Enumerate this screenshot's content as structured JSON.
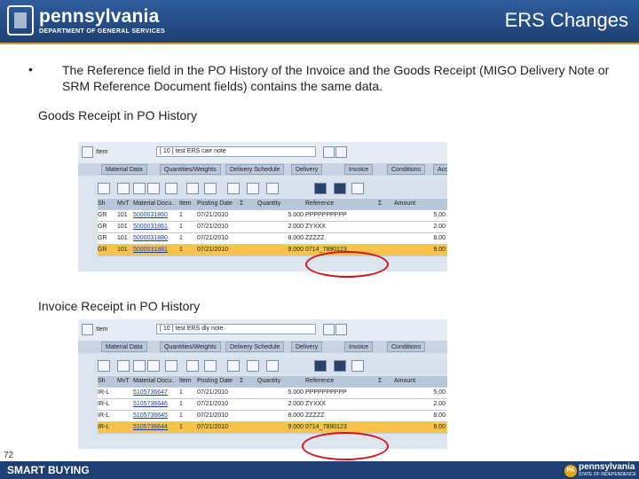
{
  "header": {
    "logo_text": "pennsylvania",
    "logo_subtext": "DEPARTMENT OF GENERAL SERVICES",
    "title": "ERS Changes"
  },
  "body": {
    "bullet": "•",
    "text": "The Reference field in the PO History of the Invoice and the Goods Receipt (MIGO Delivery Note or SRM Reference Document fields) contains the same data."
  },
  "gr": {
    "caption": "Goods Receipt in PO History",
    "item_label": "Item",
    "item_value": "[ 10 ] test ERS carr note",
    "tabs": [
      "Material Data",
      "Quantities/Weights",
      "Delivery Schedule",
      "Delivery",
      "Invoice",
      "Conditions",
      "Account As"
    ],
    "columns": [
      "Sh",
      "MvT",
      "Material Docu..",
      "Item",
      "Posting Date",
      "Σ",
      "Quantity",
      "Reference",
      "Σ",
      "Amount"
    ],
    "rows": [
      [
        "GR",
        "101",
        "5000031860",
        "1",
        "07/21/2010",
        "",
        "5.000",
        "PPPPPPPPPP",
        "",
        "5.00"
      ],
      [
        "GR",
        "101",
        "5000031861",
        "1",
        "07/21/2010",
        "",
        "2.000",
        "ZYXXX",
        "",
        "2.00"
      ],
      [
        "GR",
        "101",
        "5000031880",
        "1",
        "07/21/2010",
        "",
        "8.000",
        "ZZZZZ",
        "",
        "8.00"
      ],
      [
        "GR",
        "101",
        "5000031881",
        "1",
        "07/21/2010",
        "",
        "9.000",
        "0714_7890123",
        "",
        "9.00"
      ]
    ]
  },
  "ir": {
    "caption": "Invoice Receipt in PO History",
    "item_label": "Item",
    "item_value": "[ 10 ] test ERS dly note",
    "tabs": [
      "Material Data",
      "Quantities/Weights",
      "Delivery Schedule",
      "Delivery",
      "Invoice",
      "Conditions"
    ],
    "columns": [
      "Sh",
      "MvT",
      "Material Docu..",
      "Item",
      "Posting Date",
      "Σ",
      "Quantity",
      "Reference",
      "Σ",
      "Amount"
    ],
    "rows": [
      [
        "IR-L",
        "",
        "5105736647",
        "1",
        "07/21/2010",
        "",
        "5.000",
        "PPPPPPPPPP",
        "",
        "5.00"
      ],
      [
        "IR-L",
        "",
        "5105736646",
        "1",
        "07/21/2010",
        "",
        "2.000",
        "ZYXXX",
        "",
        "2.00"
      ],
      [
        "IR-L",
        "",
        "5105736645",
        "1",
        "07/21/2010",
        "",
        "8.000",
        "ZZZZZ",
        "",
        "8.00"
      ],
      [
        "IR-L",
        "",
        "5105736644",
        "1",
        "07/21/2010",
        "",
        "9.000",
        "0714_7890123",
        "",
        "9.00"
      ]
    ]
  },
  "footer": {
    "program": "SMART BUYING",
    "page": "72",
    "pa": "PA",
    "pa_name": "pennsylvania",
    "pa_dept": "STATE OF INDEPENDENCE"
  },
  "colors": {
    "header": "#1d3f73",
    "selected_row": "#f9c24a",
    "highlight_ring": "#d3141c"
  }
}
